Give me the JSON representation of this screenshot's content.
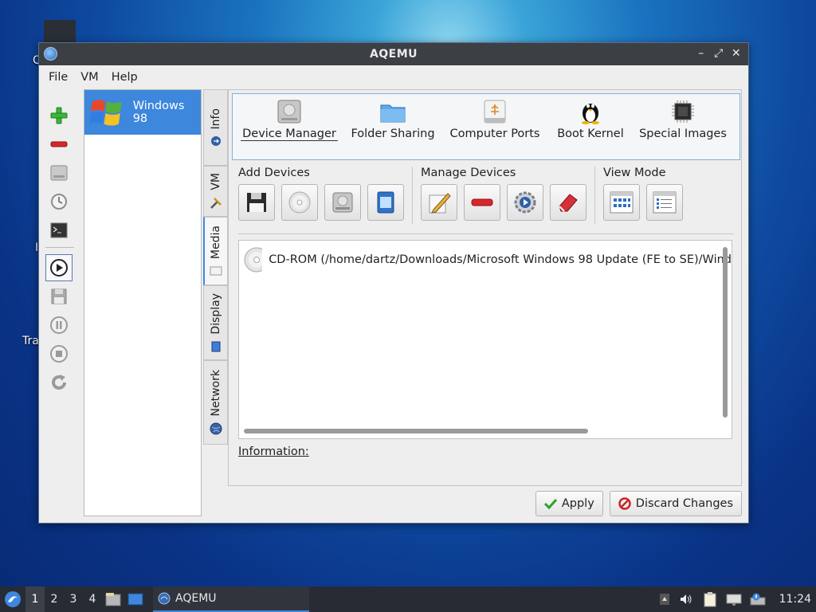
{
  "desktop": {
    "frag_left_top": "C",
    "frag_tra": "Tra",
    "frag_left_mid": "I"
  },
  "window": {
    "title": "AQEMU",
    "controls": {
      "minimize": "–",
      "maximize": "⤢",
      "close": "✕"
    }
  },
  "menu": [
    "File",
    "VM",
    "Help"
  ],
  "vm_list": [
    {
      "name": "Windows 98",
      "selected": true
    }
  ],
  "vtabs": [
    {
      "label": "Info"
    },
    {
      "label": "VM"
    },
    {
      "label": "Media",
      "selected": true
    },
    {
      "label": "Display"
    },
    {
      "label": "Network"
    }
  ],
  "media_tabs": [
    {
      "label": "Device Manager",
      "icon": "hard-disk-icon",
      "selected": true
    },
    {
      "label": "Folder Sharing",
      "icon": "folder-icon"
    },
    {
      "label": "Computer Ports",
      "icon": "usb-port-icon"
    },
    {
      "label": "Boot Kernel",
      "icon": "tux-penguin-icon"
    },
    {
      "label": "Special Images",
      "icon": "chip-icon"
    }
  ],
  "groups": {
    "add_devices": "Add Devices",
    "manage_devices": "Manage Devices",
    "view_mode": "View Mode"
  },
  "devices": [
    {
      "label": "CD-ROM (/home/dartz/Downloads/Microsoft Windows 98 Update (FE to SE)/Wind",
      "icon": "cdrom-icon"
    }
  ],
  "information_label": "Information:",
  "buttons": {
    "apply": "Apply",
    "discard": "Discard Changes"
  },
  "taskbar": {
    "workspaces": [
      "1",
      "2",
      "3",
      "4"
    ],
    "current_workspace": "1",
    "app_label": "AQEMU",
    "clock": "11:24"
  },
  "colors": {
    "selection": "#3d87dd",
    "accent_border": "#7fb0d9",
    "titlebar": "#3c3f44"
  }
}
